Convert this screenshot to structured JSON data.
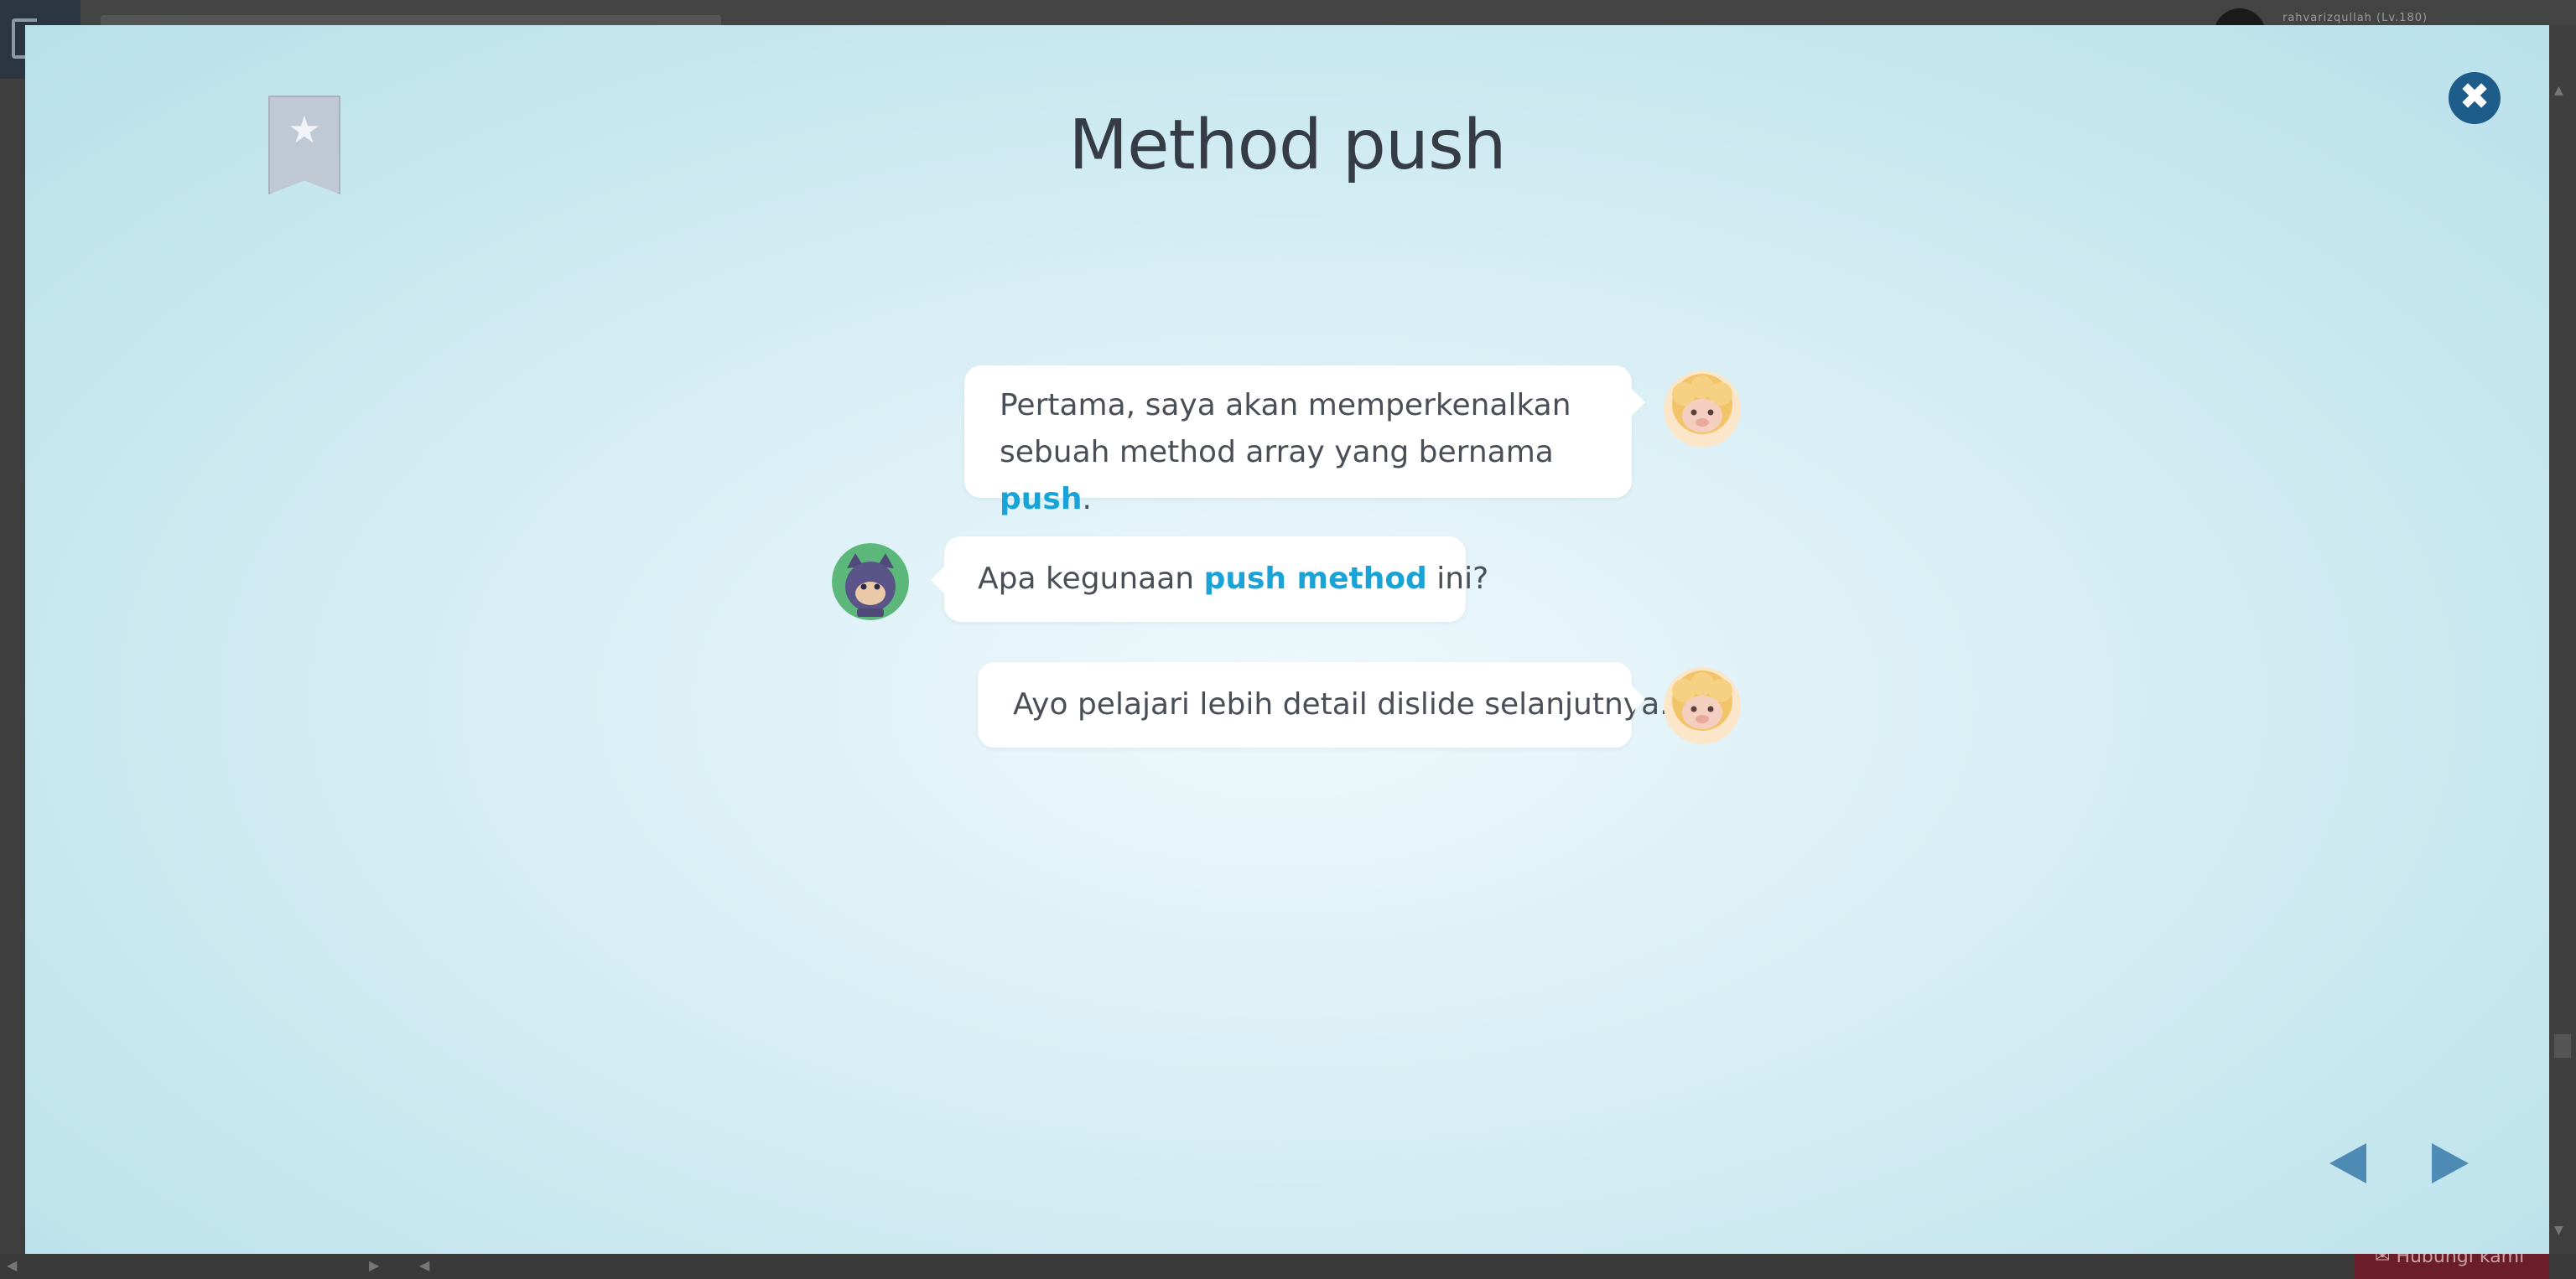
{
  "header": {
    "username": "rahvarizqullah (Lv.180)"
  },
  "footer": {
    "help_label": "Hubungi kami"
  },
  "modal": {
    "title": "Method push",
    "bookmark_icon": "star-icon",
    "close_icon": "close-icon",
    "dialog": [
      {
        "speaker": "sheep",
        "side": "right",
        "line1": "Pertama, saya akan memperkenalkan",
        "line2_prefix": "sebuah method array yang bernama ",
        "line2_highlight": "push",
        "line2_suffix": "."
      },
      {
        "speaker": "cat",
        "side": "left",
        "prefix": "Apa kegunaan ",
        "highlight": "push method",
        "suffix": " ini?"
      },
      {
        "speaker": "sheep",
        "side": "right",
        "text": "Ayo pelajari lebih detail dislide selanjutnya."
      }
    ],
    "nav": {
      "prev_icon": "triangle-left-icon",
      "next_icon": "triangle-right-icon"
    },
    "colors": {
      "highlight": "#1aa3d6",
      "close_button": "#1e5c8a",
      "nav_arrow": "#4d8ab4"
    }
  }
}
